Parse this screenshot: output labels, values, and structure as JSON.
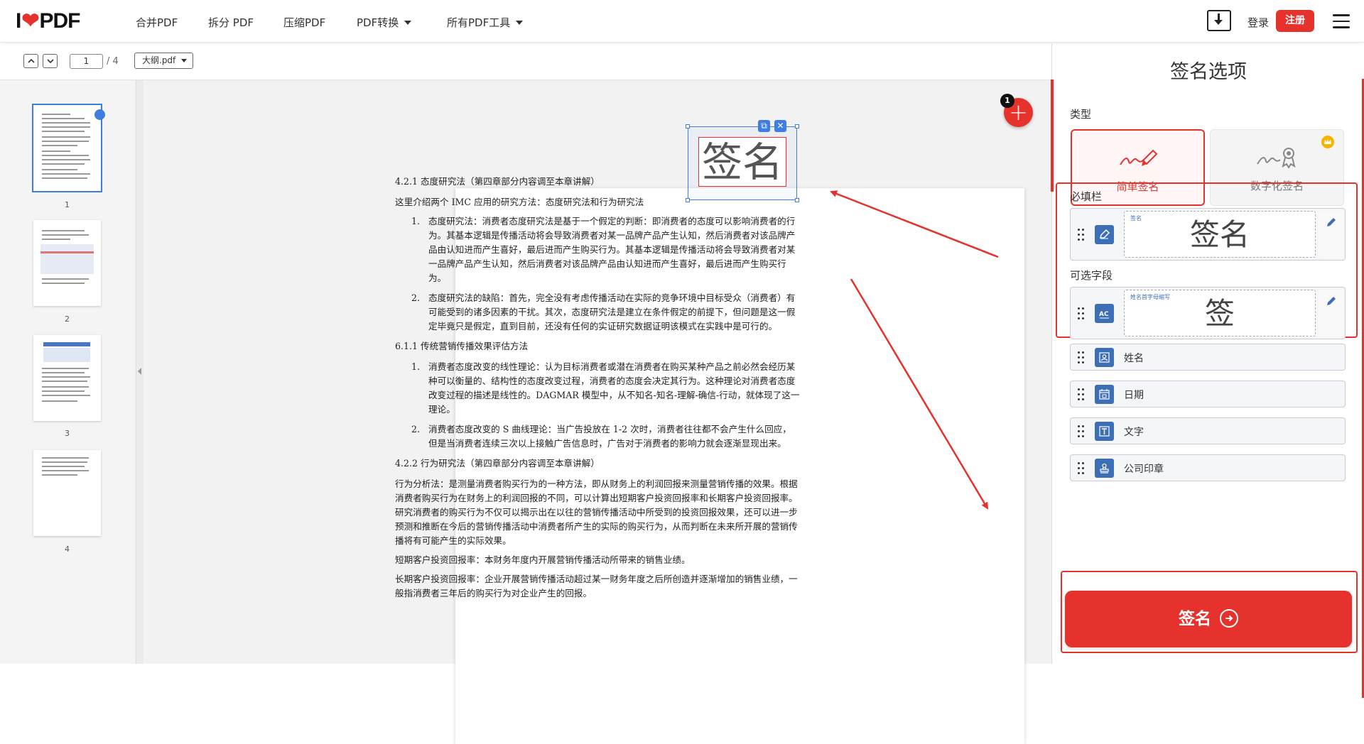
{
  "nav": {
    "logo_left": "I",
    "logo_right": "PDF",
    "items": [
      "合并PDF",
      "拆分 PDF",
      "压缩PDF",
      "PDF转换",
      "所有PDF工具"
    ],
    "login": "登录",
    "register": "注册"
  },
  "toolbar": {
    "page_current": "1",
    "page_total": "/ 4",
    "file_name": "大纲.pdf"
  },
  "thumbnails": [
    "1",
    "2",
    "3",
    "4"
  ],
  "document": {
    "sig_text": "签名",
    "h1": "4.2.1 态度研究法（第四章部分内容调至本章讲解）",
    "p1": "这里介绍两个 IMC 应用的研究方法：态度研究法和行为研究法",
    "list1": [
      {
        "n": "1.",
        "t": "态度研究法：消费者态度研究法是基于一个假定的判断：即消费者的态度可以影响消费者的行为。其基本逻辑是传播活动将会导致消费者对某一品牌产品产生认知，然后消费者对该品牌产品由认知进而产生喜好，最后进而产生购买行为。其基本逻辑是传播活动将会导致消费者对某一品牌产品产生认知，然后消费者对该品牌产品由认知进而产生喜好，最后进而产生购买行为。"
      },
      {
        "n": "2.",
        "t": "态度研究法的缺陷：首先，完全没有考虑传播活动在实际的竞争环境中目标受众（消费者）有可能受到的诸多因素的干扰。其次，态度研究法是建立在条件假定的前提下，但问题是这一假定毕竟只是假定，直到目前，还没有任何的实证研究数据证明该模式在实践中是可行的。"
      }
    ],
    "h2": "6.1.1 传统营销传播效果评估方法",
    "list2": [
      {
        "n": "1.",
        "t": "消费者态度改变的线性理论：认为目标消费者或潜在消费者在购买某种产品之前必然会经历某种可以衡量的、结构性的态度改变过程，消费者的态度会决定其行为。这种理论对消费者态度改变过程的描述是线性的。DAGMAR 模型中，从不知名-知名-理解-确信-行动，就体现了这一理论。"
      },
      {
        "n": "2.",
        "t": "消费者态度改变的 S 曲线理论：当广告投放在 1-2 次时，消费者往往都不会产生什么回应，但是当消费者连续三次以上接触广告信息时，广告对于消费者的影响力就会逐渐显现出来。"
      }
    ],
    "h3": "4.2.2 行为研究法（第四章部分内容调至本章讲解）",
    "p2": "行为分析法：是测量消费者购买行为的一种方法，即从财务上的利润回报来测量营销传播的效果。根据消费者购买行为在财务上的利润回报的不同，可以计算出短期客户投资回报率和长期客户投资回报率。研究消费者的购买行为不仅可以揭示出在以往的营销传播活动中所受到的投资回报效果，还可以进一步预测和推断在今后的营销传播活动中消费者所产生的实际的购买行为，从而判断在未来所开展的营销传播将有可能产生的实际效果。",
    "p3": "短期客户投资回报率：本财务年度内开展营销传播活动所带来的销售业绩。",
    "p4": "长期客户投资回报率：企业开展营销传播活动超过某一财务年度之后所创造并逐渐增加的销售业绩，一般指消费者三年后的购买行为对企业产生的回报。"
  },
  "add_badge": "1",
  "panel": {
    "title": "签名选项",
    "type_label": "类型",
    "simple": "简单签名",
    "digital": "数字化签名",
    "required_label": "必填栏",
    "required_field": {
      "tag": "签名",
      "preview": "签名",
      "count": "1"
    },
    "optional_label": "可选字段",
    "optional_field": {
      "tag": "姓名首字母缩写",
      "preview": "签"
    },
    "other_fields": [
      "姓名",
      "日期",
      "文字",
      "公司印章"
    ],
    "sign_button": "签名"
  },
  "colors": {
    "brand": "#e5322d",
    "field_icon": "#3d6fb6",
    "selection": "#3f7de0"
  }
}
